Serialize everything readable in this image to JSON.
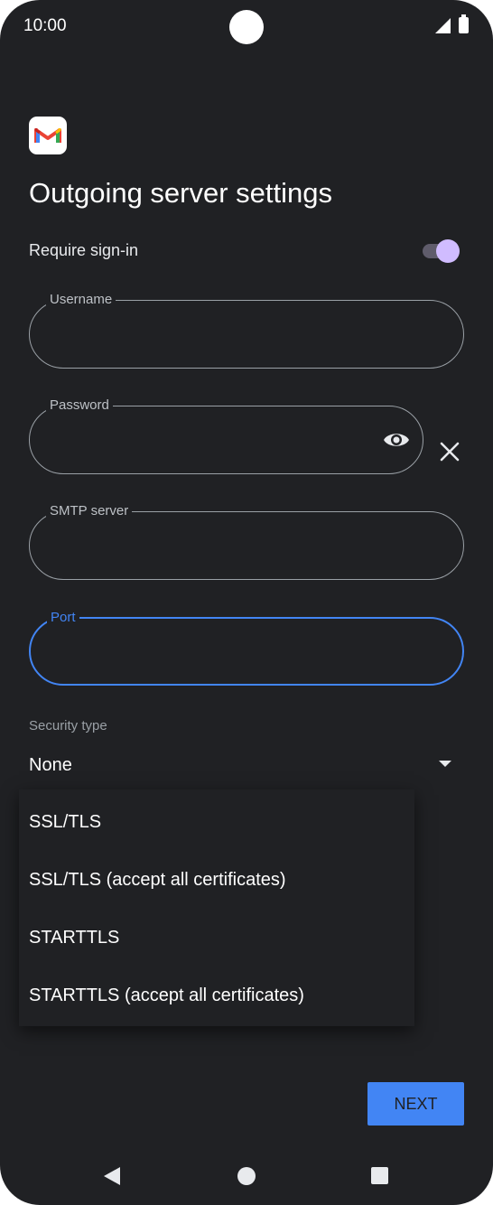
{
  "status_bar": {
    "time": "10:00"
  },
  "page": {
    "title": "Outgoing server settings"
  },
  "require_signin": {
    "label": "Require sign-in",
    "checked": true
  },
  "fields": {
    "username": {
      "label": "Username",
      "value": ""
    },
    "password": {
      "label": "Password",
      "value": ""
    },
    "smtp_server": {
      "label": "SMTP server",
      "value": ""
    },
    "port": {
      "label": "Port",
      "value": ""
    }
  },
  "security": {
    "label": "Security type",
    "selected": "None",
    "options": [
      "SSL/TLS",
      "SSL/TLS (accept all certificates)",
      "STARTTLS",
      "STARTTLS (accept all certificates)"
    ]
  },
  "next_label": "NEXT",
  "icons": {
    "app": "gmail-icon",
    "password_toggle": "eye-icon",
    "clear": "close-icon",
    "dropdown": "caret-down-icon"
  },
  "colors": {
    "background": "#202124",
    "accent": "#4285f4",
    "switch_thumb": "#d0bcff"
  }
}
